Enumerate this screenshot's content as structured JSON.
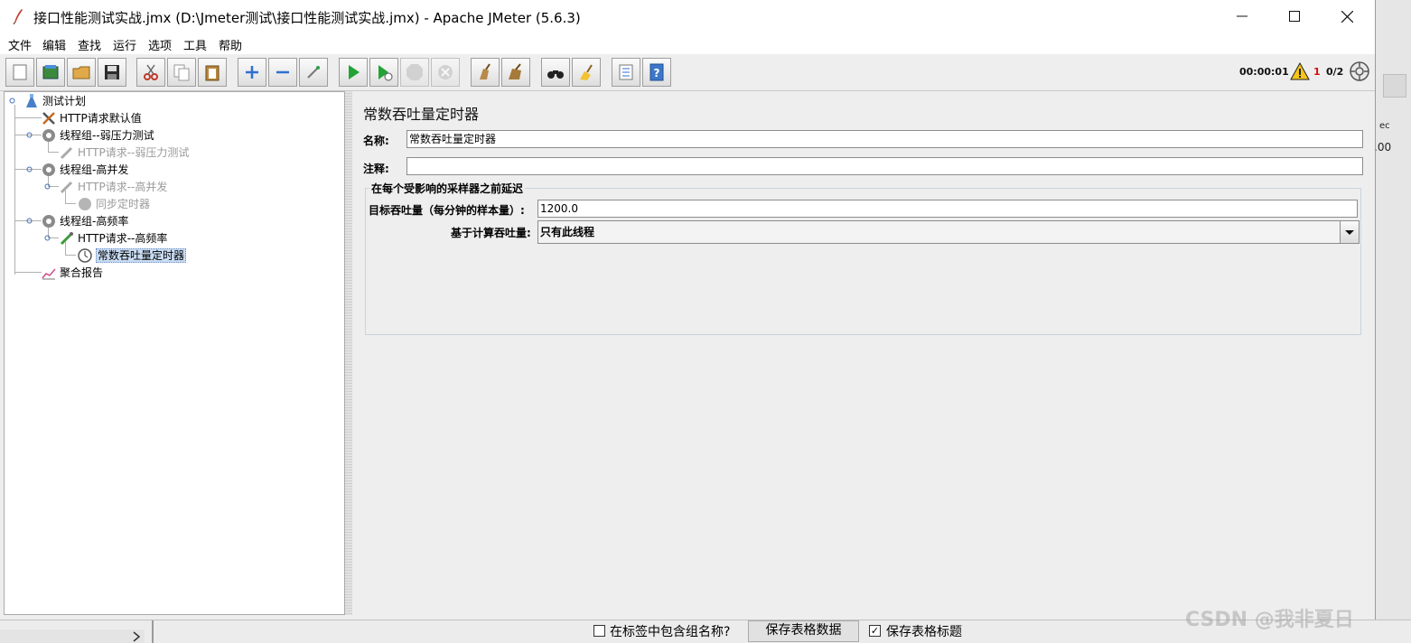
{
  "window": {
    "title": "接口性能测试实战.jmx (D:\\Jmeter测试\\接口性能测试实战.jmx) - Apache JMeter (5.6.3)"
  },
  "menu": [
    "文件",
    "编辑",
    "查找",
    "运行",
    "选项",
    "工具",
    "帮助"
  ],
  "status": {
    "elapsed": "00:00:01",
    "warnings": "1",
    "threads": "0/2"
  },
  "tree": [
    {
      "label": "测试计划",
      "icon": "test-plan-icon"
    },
    {
      "label": "HTTP请求默认值",
      "icon": "config-tools-icon"
    },
    {
      "label": "线程组--弱压力测试",
      "icon": "gear-icon"
    },
    {
      "label": "HTTP请求--弱压力测试",
      "icon": "pipette-icon"
    },
    {
      "label": "线程组-高并发",
      "icon": "gear-icon"
    },
    {
      "label": "HTTP请求--高并发",
      "icon": "pipette-icon"
    },
    {
      "label": "同步定时器",
      "icon": "timer-disabled-icon"
    },
    {
      "label": "线程组-高频率",
      "icon": "gear-icon"
    },
    {
      "label": "HTTP请求--高频率",
      "icon": "pipette-icon"
    },
    {
      "label": "常数吞吐量定时器",
      "icon": "timer-icon"
    },
    {
      "label": "聚合报告",
      "icon": "chart-icon"
    }
  ],
  "panel": {
    "heading": "常数吞吐量定时器",
    "name_label": "名称:",
    "name_value": "常数吞吐量定时器",
    "comment_label": "注释:",
    "comment_value": "",
    "group_legend": "在每个受影响的采样器之前延迟",
    "throughput_label": "目标吞吐量（每分钟的样本量）:",
    "throughput_value": "1200.0",
    "calc_label": "基于计算吞吐量:",
    "calc_value": "只有此线程"
  },
  "bottom": {
    "include_group_label": "在标签中包含组名称?",
    "save_table_button": "保存表格数据",
    "save_header_label": "保存表格标题",
    "watermark": "CSDN @我非夏日"
  },
  "background": {
    "fragment_1": "ec",
    "fragment_2": ".00"
  }
}
